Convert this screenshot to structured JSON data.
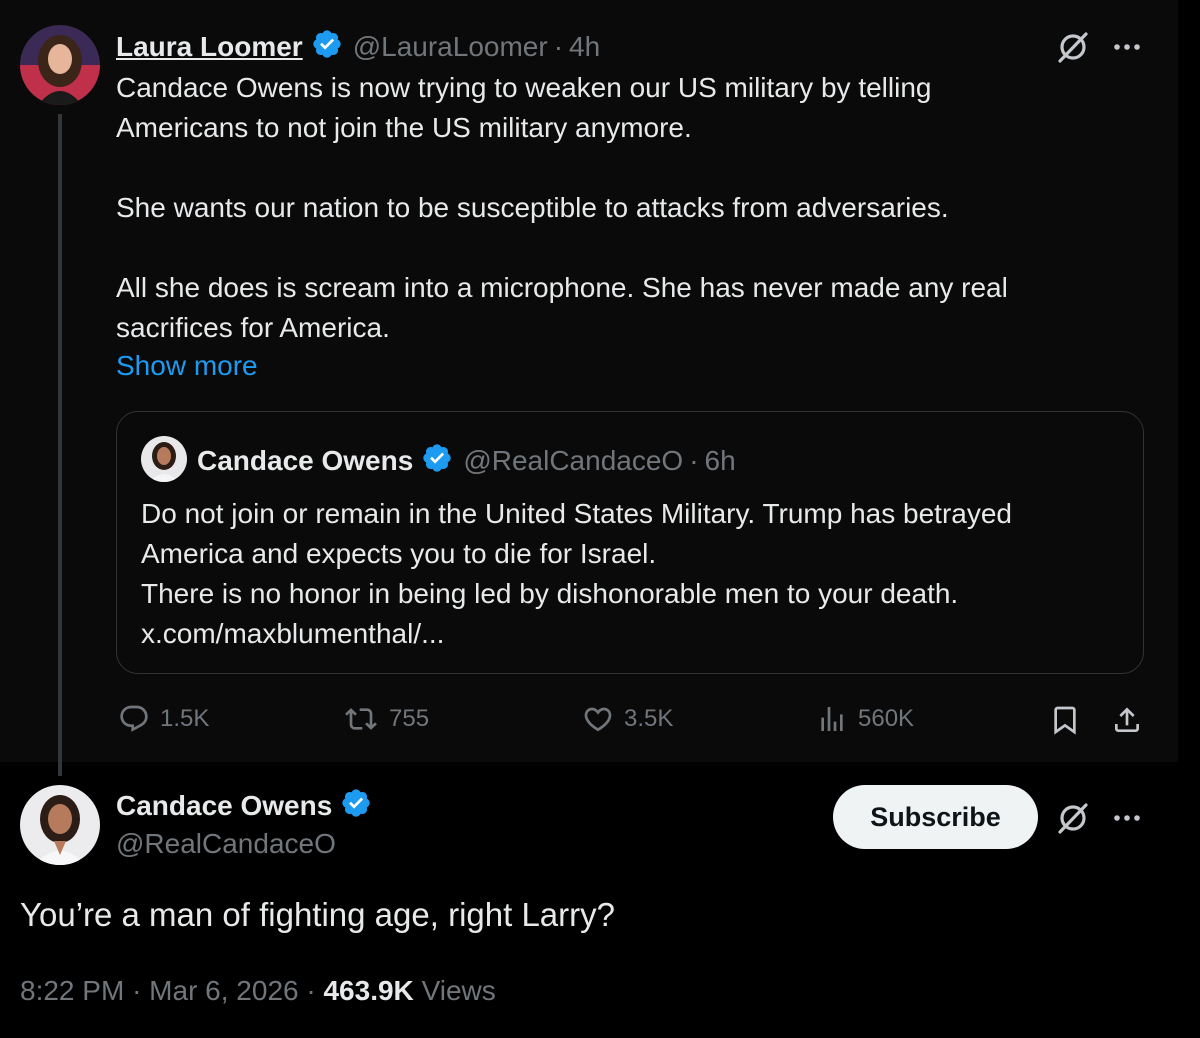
{
  "main_tweet": {
    "author_name": "Laura Loomer",
    "handle": "@LauraLoomer",
    "separator": "·",
    "time": "4h",
    "text": "Candace Owens is now trying to weaken our US military by telling\nAmericans to not join the US military anymore.\n\nShe wants our nation to be susceptible to attacks from adversaries.\n\nAll she does is scream into a microphone. She has never made any real\nsacrifices for America.",
    "show_more": "Show more",
    "quote": {
      "author_name": "Candace Owens",
      "handle": "@RealCandaceO",
      "separator": "·",
      "time": "6h",
      "text": "Do not join or remain in the United States Military. Trump has betrayed\nAmerica and expects you to die for Israel.\nThere is no honor in being led by dishonorable men to your death.\nx.com/maxblumenthal/..."
    },
    "actions": {
      "replies": "1.5K",
      "reposts": "755",
      "likes": "3.5K",
      "views": "560K"
    }
  },
  "reply_tweet": {
    "author_name": "Candace Owens",
    "handle": "@RealCandaceO",
    "subscribe_label": "Subscribe",
    "text": "You’re a man of fighting age, right Larry?",
    "time": "8:22 PM",
    "separator": "·",
    "date": "Mar 6, 2026",
    "views_count": "463.9K",
    "views_label": "Views"
  },
  "colors": {
    "accent": "#1d9bf0",
    "muted": "#71767b",
    "text": "#e7e9ea",
    "verified": "#1d9bf0"
  },
  "icons": [
    "verified-badge-icon",
    "grok-icon",
    "more-icon",
    "reply-icon",
    "repost-icon",
    "like-icon",
    "views-icon",
    "bookmark-icon",
    "share-icon"
  ]
}
